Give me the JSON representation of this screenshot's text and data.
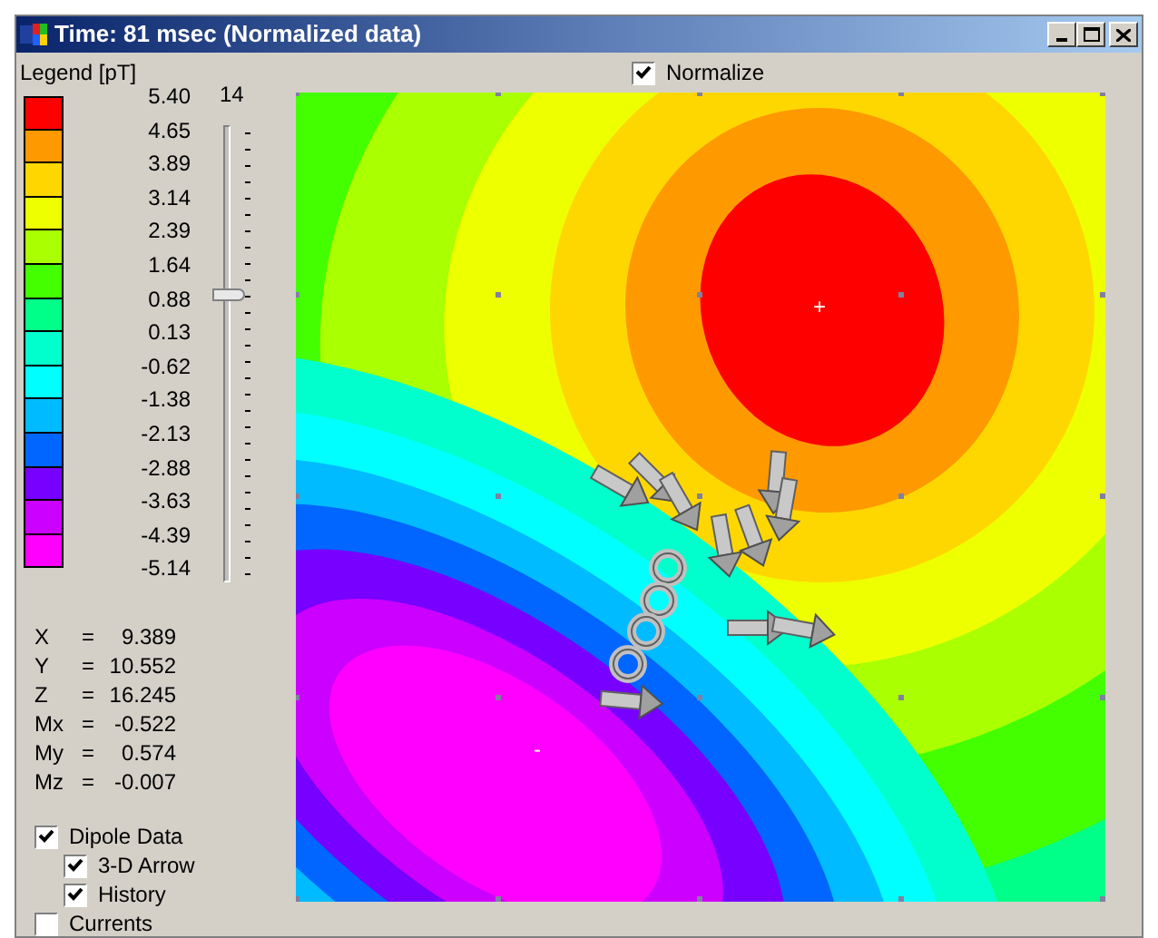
{
  "window": {
    "title": "Time: 81 msec (Normalized data)"
  },
  "normalize": {
    "label": "Normalize",
    "checked": true
  },
  "legend": {
    "title": "Legend [pT]",
    "labels": [
      "5.40",
      "4.65",
      "3.89",
      "3.14",
      "2.39",
      "1.64",
      "0.88",
      "0.13",
      "-0.62",
      "-1.38",
      "-2.13",
      "-2.88",
      "-3.63",
      "-4.39",
      "-5.14"
    ],
    "swatches": [
      {
        "color": "#ff0000"
      },
      {
        "color": "#ff9900"
      },
      {
        "color": "#ffd700"
      },
      {
        "color": "#eeff00"
      },
      {
        "color": "#aaff00"
      },
      {
        "color": "#44ff00"
      },
      {
        "color": "#00ff88"
      },
      {
        "color": "#00ffcc"
      },
      {
        "color": "#00ffff"
      },
      {
        "color": "#00bbff"
      },
      {
        "color": "#0066ff"
      },
      {
        "color": "#7700ff"
      },
      {
        "color": "#cc00ff"
      },
      {
        "color": "#ff00ff"
      }
    ]
  },
  "slider": {
    "value": "14",
    "level": 0.63
  },
  "readouts": [
    {
      "label": "X",
      "sign": "=",
      "value": "9.389"
    },
    {
      "label": "Y",
      "sign": "=",
      "value": "10.552"
    },
    {
      "label": "Z",
      "sign": "=",
      "value": "16.245"
    },
    {
      "label": "Mx",
      "sign": "=",
      "value": "-0.522"
    },
    {
      "label": "My",
      "sign": "=",
      "value": "0.574"
    },
    {
      "label": "Mz",
      "sign": "=",
      "value": "-0.007"
    }
  ],
  "options": [
    {
      "label": "Dipole Data",
      "checked": true,
      "children": [
        {
          "label": "3-D Arrow",
          "checked": true
        },
        {
          "label": "History",
          "checked": true
        }
      ]
    },
    {
      "label": "Currents",
      "checked": false
    }
  ],
  "map": {
    "positive_mark": "+",
    "negative_mark": "-"
  }
}
